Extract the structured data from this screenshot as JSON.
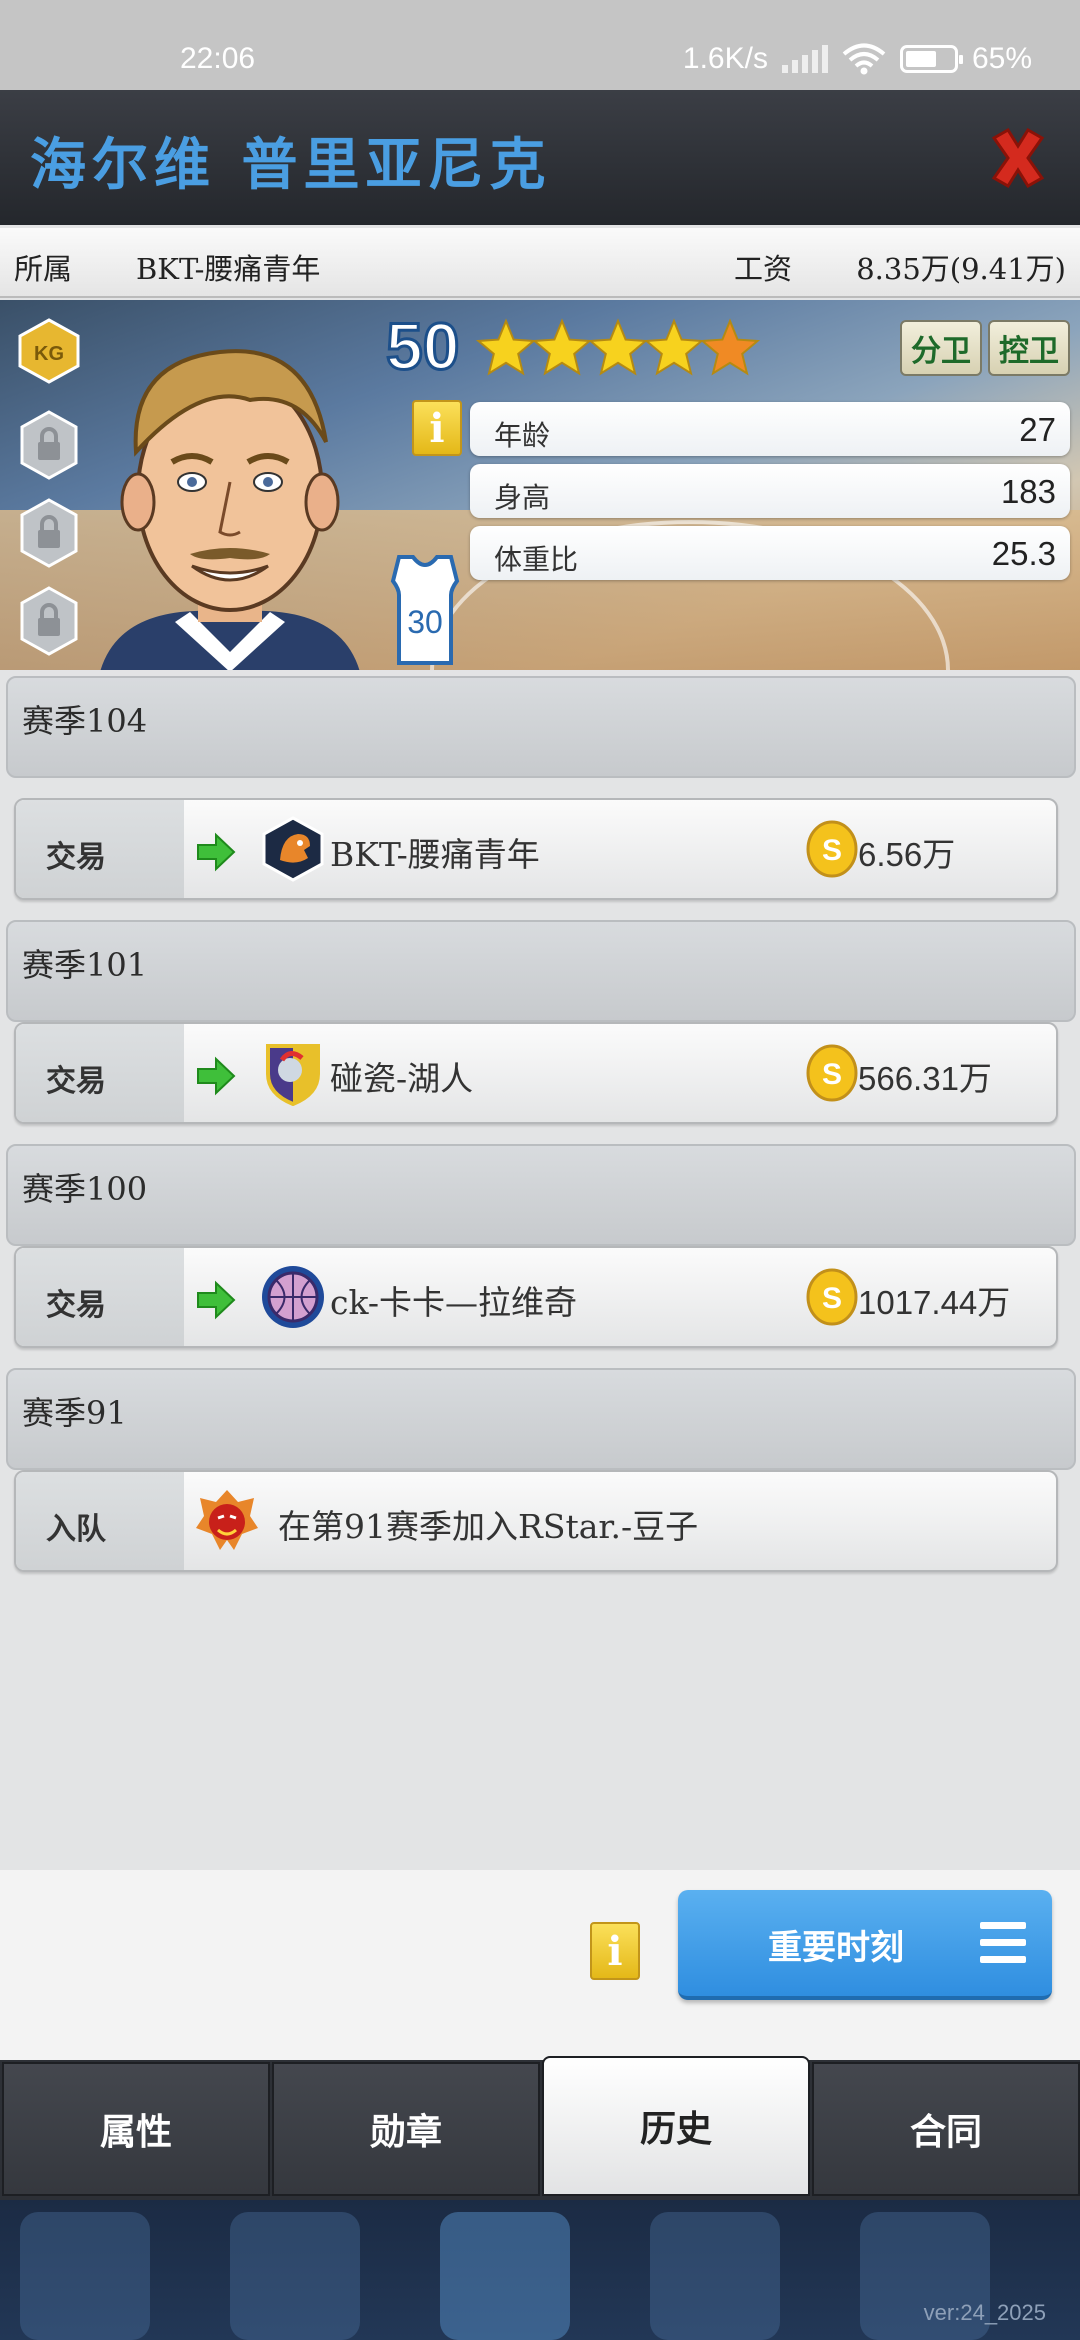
{
  "status_bar": {
    "time": "22:06",
    "network_speed": "1.6K/s",
    "battery": "65%",
    "battery_level": 0.65
  },
  "header": {
    "player_name": "海尔维 普里亚尼克",
    "close_icon": "close-x-icon"
  },
  "info": {
    "team_label": "所属",
    "team_value": "BKT-腰痛青年",
    "salary_label": "工资",
    "salary_value": "8.35万(9.41万)"
  },
  "player": {
    "rating": "50",
    "stars": 4.5,
    "badge": "KG",
    "positions": [
      "分卫",
      "控卫"
    ],
    "jersey_number": "30",
    "info_icon": "i",
    "stats": [
      {
        "label": "年龄",
        "value": "27"
      },
      {
        "label": "身高",
        "value": "183"
      },
      {
        "label": "体重比",
        "value": "25.3"
      }
    ]
  },
  "history": [
    {
      "season": "赛季104",
      "kind": "交易",
      "team": "BKT-腰痛青年",
      "price": "6.56万",
      "logo": "eagle-logo-icon"
    },
    {
      "season": "赛季101",
      "kind": "交易",
      "team": "碰瓷-湖人",
      "price": "566.31万",
      "logo": "spartan-shield-icon"
    },
    {
      "season": "赛季100",
      "kind": "交易",
      "team": "ck-卡卡—拉维奇",
      "price": "1017.44万",
      "logo": "basketball-logo-icon"
    },
    {
      "season": "赛季91",
      "kind": "入队",
      "team": "在第91赛季加入RStar.-豆子",
      "price": "",
      "logo": "dragon-logo-icon"
    }
  ],
  "actions": {
    "info_icon": "i",
    "key_moments": "重要时刻"
  },
  "tabs": [
    "属性",
    "勋章",
    "历史",
    "合同"
  ],
  "active_tab": "历史",
  "version": "ver:24_2025",
  "colors": {
    "name_blue": "#4a9ee2",
    "button_blue": "#2f8ee0",
    "tab_dark": "#35383e",
    "position_green": "#1e6a2a"
  }
}
